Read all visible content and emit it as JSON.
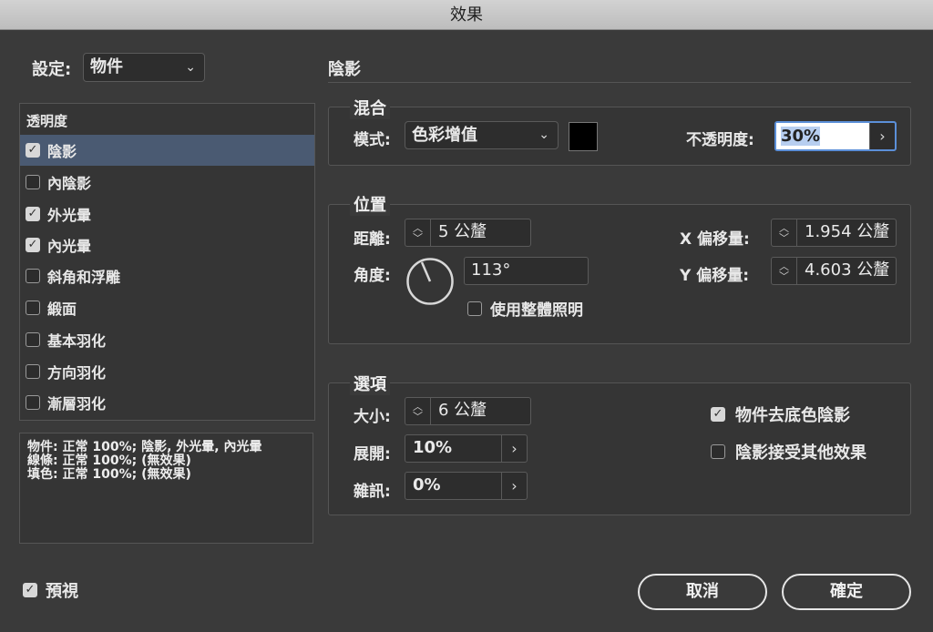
{
  "window": {
    "title": "效果"
  },
  "settings": {
    "label": "設定:",
    "selected": "物件"
  },
  "sidebar": {
    "header": "透明度",
    "items": [
      {
        "label": "陰影",
        "checked": true,
        "selected": true
      },
      {
        "label": "內陰影",
        "checked": false
      },
      {
        "label": "外光暈",
        "checked": true
      },
      {
        "label": "內光暈",
        "checked": true
      },
      {
        "label": "斜角和浮雕",
        "checked": false
      },
      {
        "label": "緞面",
        "checked": false
      },
      {
        "label": "基本羽化",
        "checked": false
      },
      {
        "label": "方向羽化",
        "checked": false
      },
      {
        "label": "漸層羽化",
        "checked": false
      }
    ],
    "summary": [
      "物件: 正常 100%; 陰影, 外光暈, 內光暈",
      "線條: 正常 100%; (無效果)",
      "填色: 正常 100%; (無效果)"
    ]
  },
  "panel": {
    "title": "陰影"
  },
  "blend": {
    "title": "混合",
    "mode_label": "模式:",
    "mode_value": "色彩增值",
    "swatch_color": "#000000",
    "opacity_label": "不透明度:",
    "opacity_value": "30%"
  },
  "position": {
    "title": "位置",
    "distance_label": "距離:",
    "distance_value": "5 公釐",
    "angle_label": "角度:",
    "angle_value": "113°",
    "use_global_label": "使用整體照明",
    "use_global_checked": false,
    "x_offset_label": "X 偏移量:",
    "x_offset_value": "1.954 公釐",
    "y_offset_label": "Y 偏移量:",
    "y_offset_value": "4.603 公釐"
  },
  "options": {
    "title": "選項",
    "size_label": "大小:",
    "size_value": "6 公釐",
    "spread_label": "展開:",
    "spread_value": "10%",
    "noise_label": "雜訊:",
    "noise_value": "0%",
    "knock_out_label": "物件去底色陰影",
    "knock_out_checked": true,
    "honor_effects_label": "陰影接受其他效果",
    "honor_effects_checked": false
  },
  "footer": {
    "preview_label": "預視",
    "preview_checked": true,
    "cancel_label": "取消",
    "ok_label": "確定"
  }
}
